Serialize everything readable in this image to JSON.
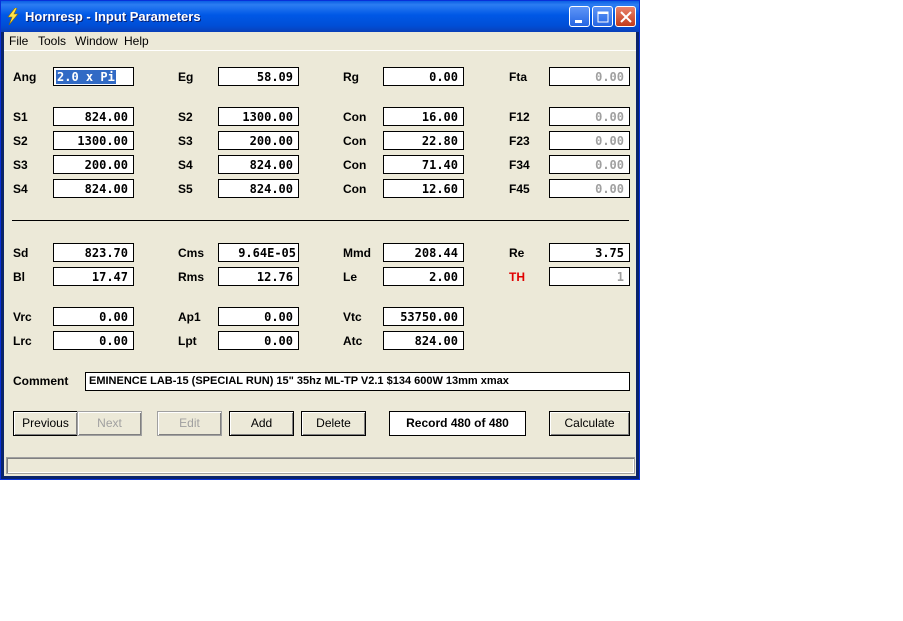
{
  "window": {
    "title": "Hornresp - Input Parameters"
  },
  "menu": [
    "File",
    "Tools",
    "Window",
    "Help"
  ],
  "params": {
    "ang": {
      "label": "Ang",
      "value": "2.0 x Pi"
    },
    "eg": {
      "label": "Eg",
      "value": "58.09"
    },
    "rg": {
      "label": "Rg",
      "value": "0.00"
    },
    "fta": {
      "label": "Fta",
      "value": "0.00"
    },
    "s1": {
      "label": "S1",
      "value": "824.00"
    },
    "s2a": {
      "label": "S2",
      "value": "1300.00"
    },
    "con1": {
      "label": "Con",
      "value": "16.00"
    },
    "f12": {
      "label": "F12",
      "value": "0.00"
    },
    "s2b": {
      "label": "S2",
      "value": "1300.00"
    },
    "s3a": {
      "label": "S3",
      "value": "200.00"
    },
    "con2": {
      "label": "Con",
      "value": "22.80"
    },
    "f23": {
      "label": "F23",
      "value": "0.00"
    },
    "s3b": {
      "label": "S3",
      "value": "200.00"
    },
    "s4a": {
      "label": "S4",
      "value": "824.00"
    },
    "con3": {
      "label": "Con",
      "value": "71.40"
    },
    "f34": {
      "label": "F34",
      "value": "0.00"
    },
    "s4b": {
      "label": "S4",
      "value": "824.00"
    },
    "s5": {
      "label": "S5",
      "value": "824.00"
    },
    "con4": {
      "label": "Con",
      "value": "12.60"
    },
    "f45": {
      "label": "F45",
      "value": "0.00"
    },
    "sd": {
      "label": "Sd",
      "value": "823.70"
    },
    "cms": {
      "label": "Cms",
      "value": "9.64E-05"
    },
    "mmd": {
      "label": "Mmd",
      "value": "208.44"
    },
    "re": {
      "label": "Re",
      "value": "3.75"
    },
    "bl": {
      "label": "Bl",
      "value": "17.47"
    },
    "rms": {
      "label": "Rms",
      "value": "12.76"
    },
    "le": {
      "label": "Le",
      "value": "2.00"
    },
    "th": {
      "label": "TH",
      "value": "1"
    },
    "vrc": {
      "label": "Vrc",
      "value": "0.00"
    },
    "ap1": {
      "label": "Ap1",
      "value": "0.00"
    },
    "vtc": {
      "label": "Vtc",
      "value": "53750.00"
    },
    "lrc": {
      "label": "Lrc",
      "value": "0.00"
    },
    "lpt": {
      "label": "Lpt",
      "value": "0.00"
    },
    "atc": {
      "label": "Atc",
      "value": "824.00"
    }
  },
  "comment": {
    "label": "Comment",
    "value": "EMINENCE LAB-15 (SPECIAL RUN) 15\" 35hz ML-TP V2.1 $134 600W 13mm xmax"
  },
  "buttons": {
    "previous": "Previous",
    "next": "Next",
    "edit": "Edit",
    "add": "Add",
    "delete": "Delete",
    "calculate": "Calculate"
  },
  "record": "Record 480 of 480",
  "colors": {
    "titlebar": "#0058e6",
    "face": "#ece9d8",
    "highlight": "#316ac5",
    "warning_label": "#e00000"
  }
}
